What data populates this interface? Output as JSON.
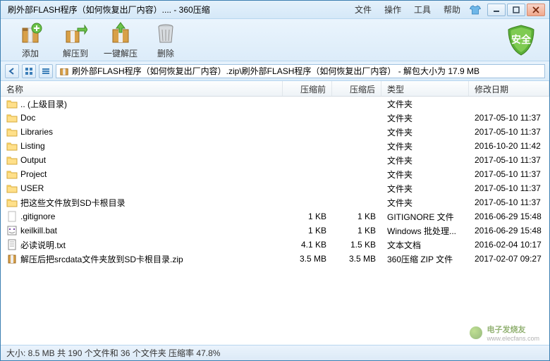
{
  "window": {
    "title": "刷外部FLASH程序（如何恢复出厂内容）.... - 360压缩"
  },
  "menu": {
    "file": "文件",
    "operation": "操作",
    "tools": "工具",
    "help": "帮助"
  },
  "toolbar": {
    "add": "添加",
    "extract_to": "解压到",
    "one_click": "一键解压",
    "delete": "删除",
    "shield_text": "安全"
  },
  "path": {
    "text": "刷外部FLASH程序（如何恢复出厂内容）.zip\\刷外部FLASH程序（如何恢复出厂内容） - 解包大小为 17.9 MB"
  },
  "columns": {
    "name": "名称",
    "before": "压缩前",
    "after": "压缩后",
    "type": "类型",
    "modified": "修改日期"
  },
  "files": [
    {
      "icon": "folder",
      "name": ".. (上级目录)",
      "before": "",
      "after": "",
      "type": "文件夹",
      "date": ""
    },
    {
      "icon": "folder",
      "name": "Doc",
      "before": "",
      "after": "",
      "type": "文件夹",
      "date": "2017-05-10 11:37"
    },
    {
      "icon": "folder",
      "name": "Libraries",
      "before": "",
      "after": "",
      "type": "文件夹",
      "date": "2017-05-10 11:37"
    },
    {
      "icon": "folder",
      "name": "Listing",
      "before": "",
      "after": "",
      "type": "文件夹",
      "date": "2016-10-20 11:42"
    },
    {
      "icon": "folder",
      "name": "Output",
      "before": "",
      "after": "",
      "type": "文件夹",
      "date": "2017-05-10 11:37"
    },
    {
      "icon": "folder",
      "name": "Project",
      "before": "",
      "after": "",
      "type": "文件夹",
      "date": "2017-05-10 11:37"
    },
    {
      "icon": "folder",
      "name": "USER",
      "before": "",
      "after": "",
      "type": "文件夹",
      "date": "2017-05-10 11:37"
    },
    {
      "icon": "folder",
      "name": "把这些文件放到SD卡根目录",
      "before": "",
      "after": "",
      "type": "文件夹",
      "date": "2017-05-10 11:37"
    },
    {
      "icon": "file",
      "name": ".gitignore",
      "before": "1 KB",
      "after": "1 KB",
      "type": "GITIGNORE 文件",
      "date": "2016-06-29 15:48"
    },
    {
      "icon": "bat",
      "name": "keilkill.bat",
      "before": "1 KB",
      "after": "1 KB",
      "type": "Windows 批处理...",
      "date": "2016-06-29 15:48"
    },
    {
      "icon": "txt",
      "name": "必读说明.txt",
      "before": "4.1 KB",
      "after": "1.5 KB",
      "type": "文本文档",
      "date": "2016-02-04 10:17"
    },
    {
      "icon": "zip",
      "name": "解压后把srcdata文件夹放到SD卡根目录.zip",
      "before": "3.5 MB",
      "after": "3.5 MB",
      "type": "360压缩 ZIP 文件",
      "date": "2017-02-07 09:27"
    }
  ],
  "status": {
    "text": "大小: 8.5 MB 共 190 个文件和 36 个文件夹 压缩率 47.8%"
  },
  "watermark": {
    "text": "电子发烧友",
    "url": "www.elecfans.com"
  }
}
